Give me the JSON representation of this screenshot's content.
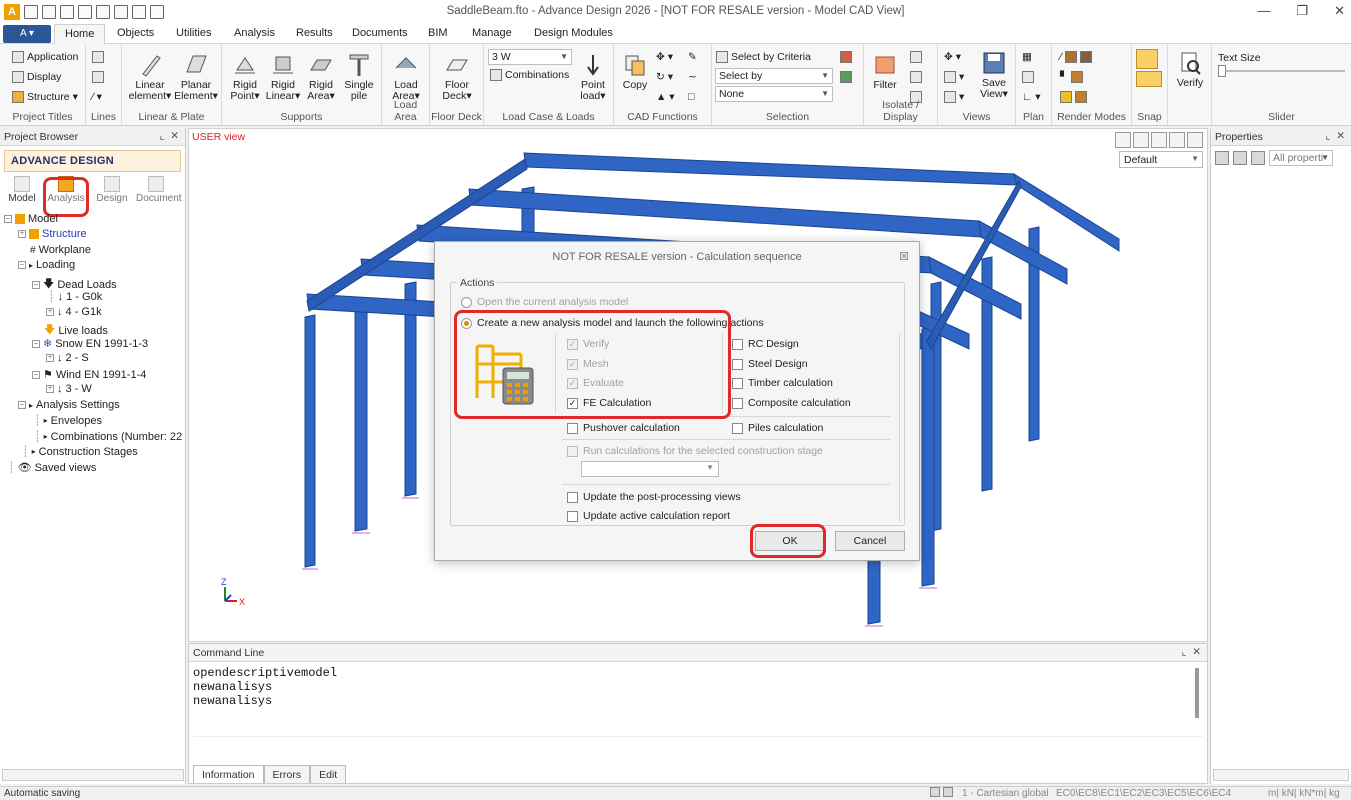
{
  "window": {
    "title": "SaddleBeam.fto - Advance Design 2026 - [NOT FOR RESALE version - Model CAD View]"
  },
  "tabs": [
    "Home",
    "Objects",
    "Utilities",
    "Analysis",
    "Results",
    "Documents",
    "BIM",
    "Manage",
    "Design Modules"
  ],
  "ribbon": {
    "project_titles": {
      "application": "Application",
      "display": "Display",
      "structure": "Structure",
      "label": "Project Titles"
    },
    "lines": {
      "label": "Lines"
    },
    "linear_plate": {
      "linear_element": "Linear element",
      "planar_element": "Planar Element",
      "label": "Linear & Plate"
    },
    "supports": {
      "rigid_point": "Rigid Point",
      "rigid_linear": "Rigid Linear",
      "rigid_area": "Rigid Area",
      "single_pile": "Single pile",
      "label": "Supports"
    },
    "load_area": {
      "btn": "Load Area",
      "label": "Load Area"
    },
    "floor_deck": {
      "btn": "Floor Deck",
      "label": "Floor Deck"
    },
    "load_case": {
      "case_value": "3 W",
      "combinations": "Combinations",
      "point_load": "Point load",
      "label": "Load Case & Loads"
    },
    "cad": {
      "copy": "Copy",
      "label": "CAD Functions"
    },
    "selection": {
      "select_by_criteria": "Select by Criteria",
      "select_by": "Select by",
      "none": "None",
      "label": "Selection"
    },
    "isolate": {
      "filter": "Filter",
      "label": "Isolate / Display"
    },
    "views": {
      "save_view": "Save View",
      "label": "Views"
    },
    "plan": {
      "label": "Plan"
    },
    "render": {
      "label": "Render Modes"
    },
    "snap": {
      "label": "Snap"
    },
    "verify": {
      "btn": "Verify"
    },
    "slider": {
      "text_size": "Text Size",
      "label": "Slider"
    }
  },
  "project_browser": {
    "title": "Project Browser",
    "logo": "ADVANCE DESIGN",
    "modes": [
      "Model",
      "Analysis",
      "Design",
      "Document"
    ],
    "tree": [
      {
        "label": "Model"
      },
      {
        "label": "Structure"
      },
      {
        "label": "Workplane"
      },
      {
        "label": "Loading"
      },
      {
        "label": "Dead Loads"
      },
      {
        "label": "1 - G0k"
      },
      {
        "label": "4 - G1k"
      },
      {
        "label": "Live loads"
      },
      {
        "label": "Snow EN 1991-1-3"
      },
      {
        "label": "2 - S"
      },
      {
        "label": "Wind EN 1991-1-4"
      },
      {
        "label": "3 - W"
      },
      {
        "label": "Analysis Settings"
      },
      {
        "label": "Envelopes"
      },
      {
        "label": "Combinations (Number: 22"
      },
      {
        "label": "Construction Stages"
      },
      {
        "label": "Saved views"
      }
    ]
  },
  "viewport": {
    "user_view": "USER view",
    "view_combo": "Default",
    "axis_z": "Z",
    "axis_x": "X"
  },
  "properties": {
    "title": "Properties",
    "filter": "All properti"
  },
  "command_line": {
    "title": "Command Line",
    "lines": [
      "opendescriptivemodel",
      "newanalisys",
      "newanalisys"
    ],
    "tabs": [
      "Information",
      "Errors",
      "Edit"
    ]
  },
  "status": {
    "left": "Automatic saving",
    "coord": "1 - Cartesian global",
    "codes": "EC0\\EC8\\EC1\\EC2\\EC3\\EC5\\EC6\\EC4",
    "units": "m| kN| kN*m| kg"
  },
  "dialog": {
    "title": "NOT FOR RESALE version - Calculation sequence",
    "actions_label": "Actions",
    "radio_open": "Open the current analysis model",
    "radio_create": "Create a new analysis model and launch the following actions",
    "verify": "Verify",
    "mesh": "Mesh",
    "evaluate": "Evaluate",
    "fe_calc": "FE Calculation",
    "rc_design": "RC Design",
    "steel_design": "Steel Design",
    "timber_calc": "Timber calculation",
    "composite_calc": "Composite calculation",
    "pushover": "Pushover calculation",
    "piles": "Piles calculation",
    "run_stage": "Run calculations for the selected construction stage",
    "update_post": "Update the post-processing views",
    "update_report": "Update active calculation report",
    "ok": "OK",
    "cancel": "Cancel"
  },
  "colors": {
    "accent": "#2b5797",
    "beam": "#2f66c6",
    "highlight": "#e02a2a",
    "user_view": "#e02020"
  }
}
